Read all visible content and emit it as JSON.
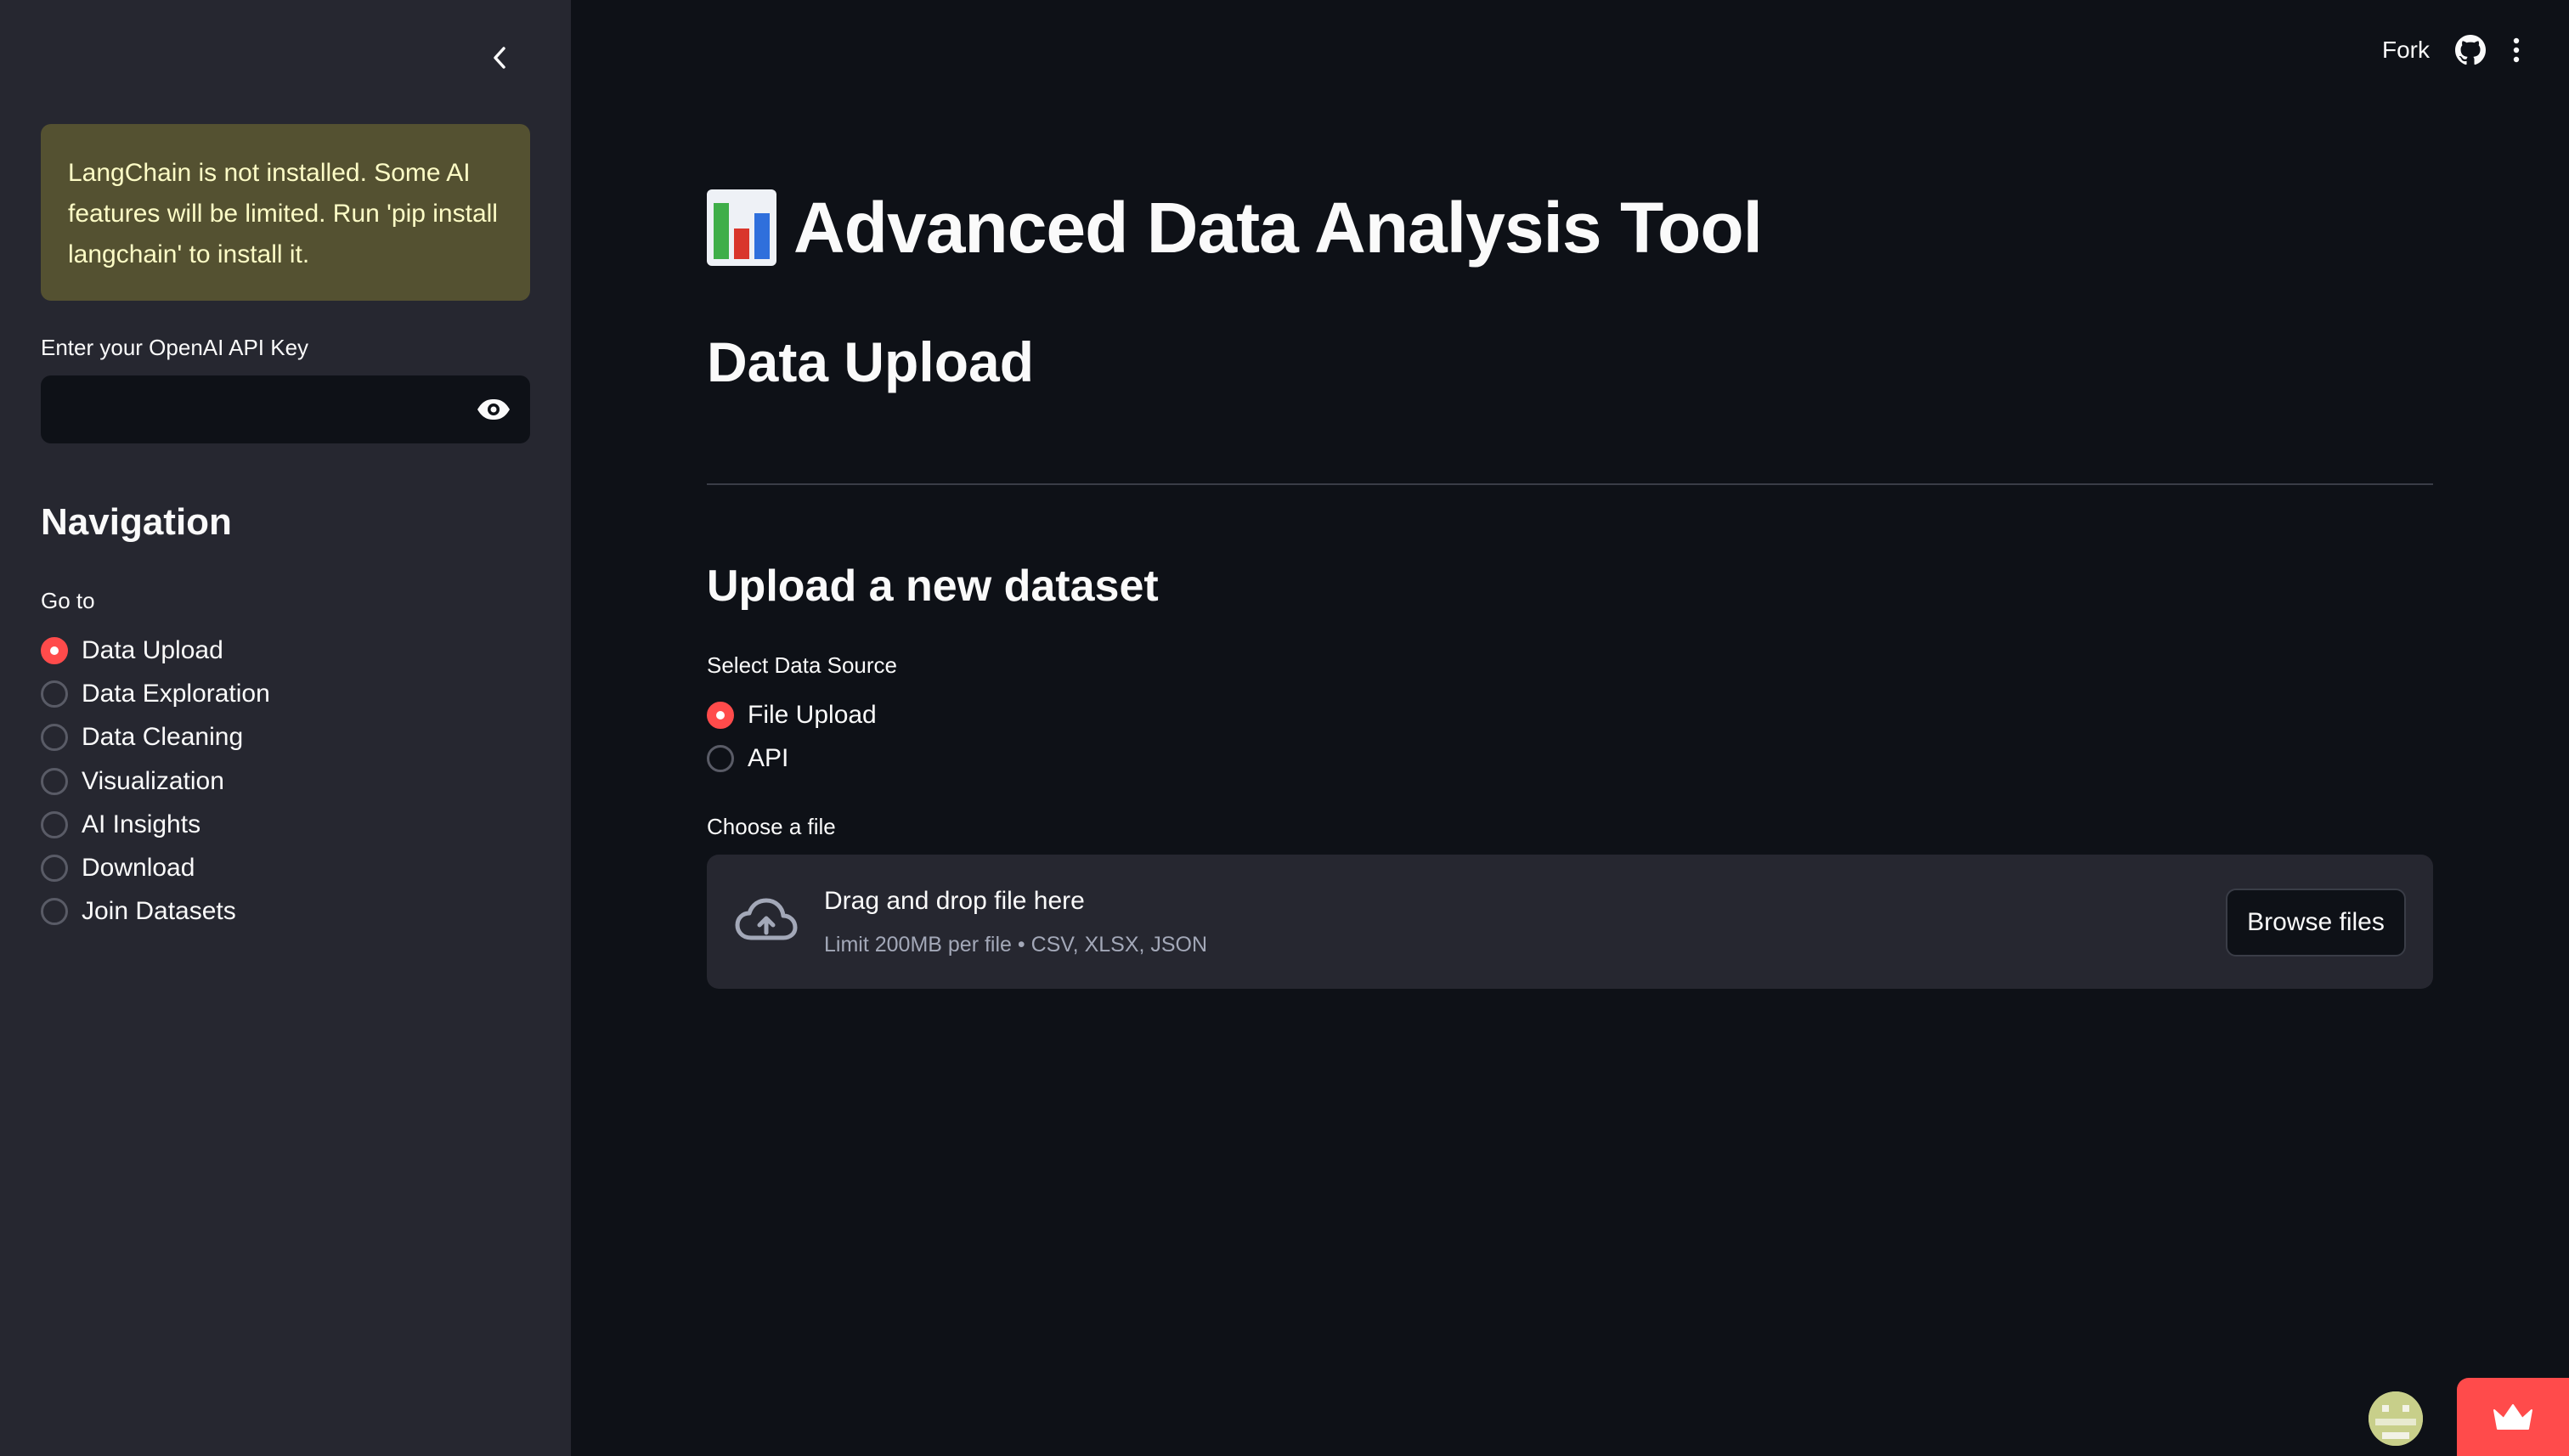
{
  "sidebar": {
    "warning": "LangChain is not installed. Some AI features will be limited. Run 'pip install langchain' to install it.",
    "api_key_label": "Enter your OpenAI API Key",
    "api_key_value": "",
    "navigation_title": "Navigation",
    "goto_label": "Go to",
    "nav_options": [
      {
        "label": "Data Upload",
        "selected": true
      },
      {
        "label": "Data Exploration",
        "selected": false
      },
      {
        "label": "Data Cleaning",
        "selected": false
      },
      {
        "label": "Visualization",
        "selected": false
      },
      {
        "label": "AI Insights",
        "selected": false
      },
      {
        "label": "Download",
        "selected": false
      },
      {
        "label": "Join Datasets",
        "selected": false
      }
    ]
  },
  "header": {
    "fork_label": "Fork",
    "icons": [
      "github-icon",
      "more-vertical-icon"
    ]
  },
  "main": {
    "title": "Advanced Data Analysis Tool",
    "subtitle": "Data Upload",
    "upload_heading": "Upload a new dataset",
    "source_label": "Select Data Source",
    "source_options": [
      {
        "label": "File Upload",
        "selected": true
      },
      {
        "label": "API",
        "selected": false
      }
    ],
    "choose_label": "Choose a file",
    "dropzone": {
      "title": "Drag and drop file here",
      "limit": "Limit 200MB per file • CSV, XLSX, JSON",
      "button": "Browse files"
    }
  },
  "colors": {
    "accent": "#ff4b4b",
    "background": "#0e1117",
    "sidebar": "#262730",
    "warning_bg": "#545131",
    "warning_text": "#fdfcc6"
  }
}
